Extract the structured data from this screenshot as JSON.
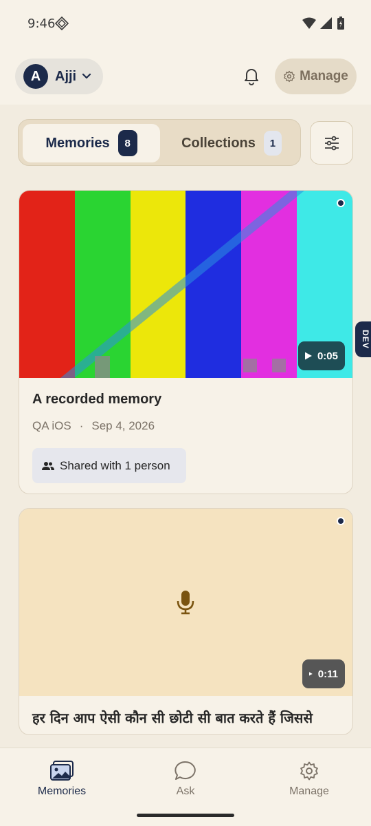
{
  "status_bar": {
    "time": "9:46"
  },
  "header": {
    "account": {
      "initial": "A",
      "name": "Ajji"
    },
    "manage_label": "Manage"
  },
  "tabs": [
    {
      "label": "Memories",
      "count": "8",
      "active": true
    },
    {
      "label": "Collections",
      "count": "1",
      "active": false
    }
  ],
  "dev_label": "DEV",
  "cards": [
    {
      "title": "A recorded memory",
      "author": "QA iOS",
      "separator": "·",
      "date": "Sep 4, 2026",
      "duration": "0:05",
      "shared": "Shared with 1 person",
      "thumbnail_colors": [
        "#e22318",
        "#2ad432",
        "#ece70a",
        "#1f2de0",
        "#e22fe0",
        "#3ee9e7"
      ]
    },
    {
      "title": "हर दिन आप ऐसी कौन सी छोटी सी बात करते हैं जिससे",
      "duration": "0:11",
      "thumbnail_color": "#f5e3c0",
      "icon": "microphone-icon"
    }
  ],
  "bottom_nav": [
    {
      "label": "Memories",
      "icon": "photos-icon",
      "active": true
    },
    {
      "label": "Ask",
      "icon": "chat-bubble-icon",
      "active": false
    },
    {
      "label": "Manage",
      "icon": "gear-icon",
      "active": false
    }
  ],
  "colors": {
    "navy": "#1c2a4a",
    "background": "#f2ece0",
    "surface": "#f7f2e8"
  }
}
